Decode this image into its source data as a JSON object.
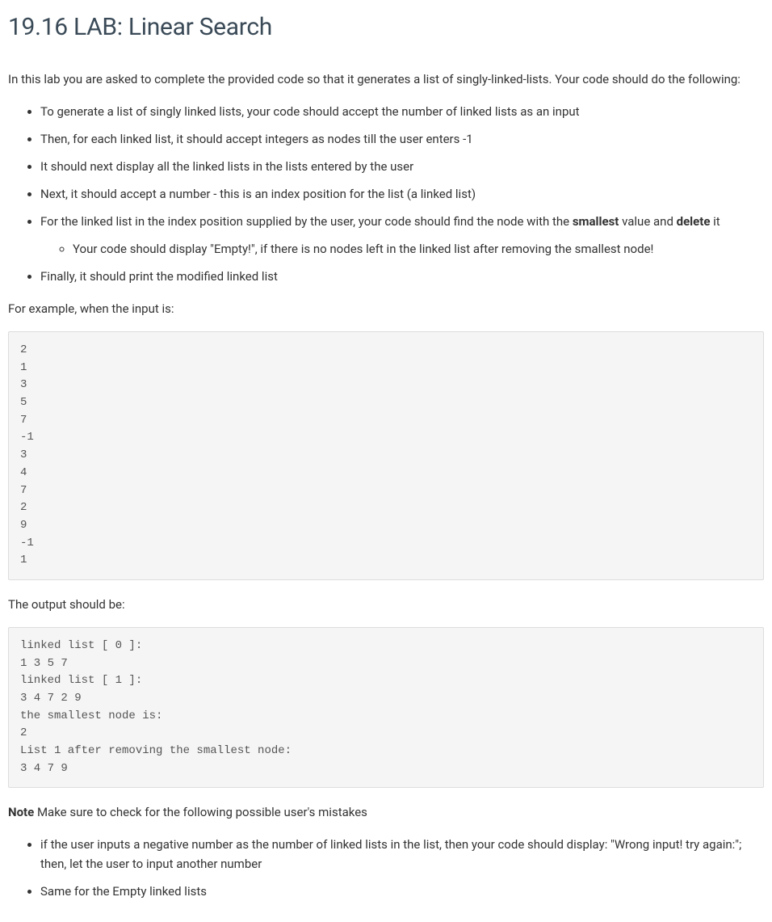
{
  "title": "19.16 LAB: Linear Search",
  "intro": "In this lab you are asked to complete the provided code so that it generates a list of singly-linked-lists. Your code should do the following:",
  "bullets": {
    "b1": "To generate a list of singly linked lists, your code should accept the number of linked lists as an input",
    "b2": "Then, for each linked list, it should accept integers as nodes till the user enters -1",
    "b3": "It should next display all the linked lists in the lists entered by the user",
    "b4": "Next, it should accept a number - this is an index position for the list (a linked list)",
    "b5_prefix": "For the linked list in the index position supplied by the user, your code should find the node with the ",
    "b5_bold1": "smallest",
    "b5_mid": " value and ",
    "b5_bold2": "delete",
    "b5_suffix": " it",
    "b5_sub": "Your code should display \"Empty!\", if there is no nodes left in the linked list after removing the smallest node!",
    "b6": "Finally, it should print the modified linked list"
  },
  "example_label": "For example, when the input is:",
  "input_block": "2\n1\n3\n5\n7\n-1\n3\n4\n7\n2\n9\n-1\n1",
  "output_label": "The output should be:",
  "output_block": "linked list [ 0 ]:\n1 3 5 7\nlinked list [ 1 ]:\n3 4 7 2 9\nthe smallest node is:\n2\nList 1 after removing the smallest node:\n3 4 7 9",
  "note_label": "Note",
  "note_text": " Make sure to check for the following possible user's mistakes",
  "note_bullets": {
    "n1": "if the user inputs a negative number as the number of linked lists in the list, then your code should display: \"Wrong input! try again:\"; then, let the user to input another number",
    "n2": "Same for the Empty linked lists"
  }
}
